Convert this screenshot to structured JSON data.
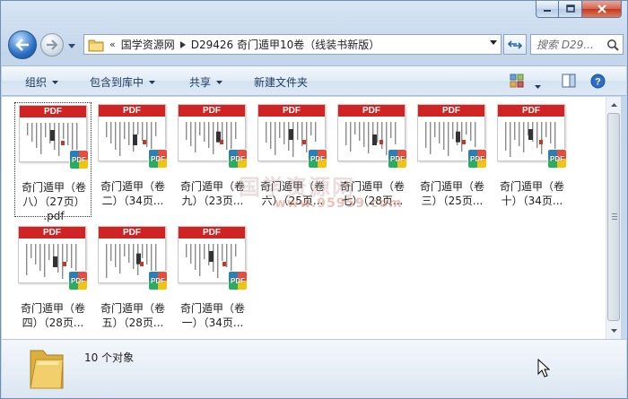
{
  "window": {
    "caption_buttons": [
      "minimize",
      "maximize",
      "close"
    ]
  },
  "address_bar": {
    "overflow": "«",
    "crumbs": [
      "国学资源网",
      "D29426 奇门遁甲10卷（线装书新版）"
    ]
  },
  "search": {
    "placeholder": "搜索 D29..."
  },
  "toolbar": {
    "organize": "组织",
    "include_in_library": "包含到库中",
    "share": "共享",
    "new_folder": "新建文件夹"
  },
  "files": [
    {
      "line1": "奇门遁甲（卷",
      "line2": "八）（27页）",
      "line3": ".pdf",
      "selected": true
    },
    {
      "line1": "奇门遁甲（卷",
      "line2": "二）（34页...",
      "line3": "",
      "selected": false
    },
    {
      "line1": "奇门遁甲（卷",
      "line2": "九）（23页...",
      "line3": "",
      "selected": false
    },
    {
      "line1": "奇门遁甲（卷",
      "line2": "六）（25页...",
      "line3": "",
      "selected": false
    },
    {
      "line1": "奇门遁甲（卷",
      "line2": "七）（28页...",
      "line3": "",
      "selected": false
    },
    {
      "line1": "奇门遁甲（卷",
      "line2": "三）（25页...",
      "line3": "",
      "selected": false
    },
    {
      "line1": "奇门遁甲（卷",
      "line2": "十）（34页...",
      "line3": "",
      "selected": false
    },
    {
      "line1": "奇门遁甲（卷",
      "line2": "四）（28页...",
      "line3": "",
      "selected": false
    },
    {
      "line1": "奇门遁甲（卷",
      "line2": "五）（28页...",
      "line3": "",
      "selected": false
    },
    {
      "line1": "奇门遁甲（卷",
      "line2": "一）（34页...",
      "line3": "",
      "selected": false
    }
  ],
  "thumbnail": {
    "band_text": "PDF",
    "badge_text": "PDF",
    "band_color": "#d02424"
  },
  "watermark": {
    "main": "国学资源网",
    "sub": "www.95959.com"
  },
  "details": {
    "count": "10 个对象"
  },
  "icons": [
    "back-arrow-icon",
    "forward-arrow-icon",
    "folder-icon",
    "refresh-icon",
    "search-icon",
    "view-icon",
    "preview-pane-icon",
    "help-icon",
    "pdf-file-icon",
    "mouse-cursor-icon"
  ]
}
